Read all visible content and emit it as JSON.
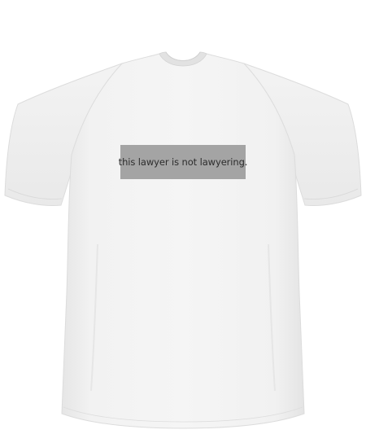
{
  "product": {
    "shirt_color": "#f1f1f1",
    "print_background_color": "#a4a4a4",
    "print_text_color": "#2c2c2c",
    "print_text": "this lawyer is not lawyering."
  }
}
